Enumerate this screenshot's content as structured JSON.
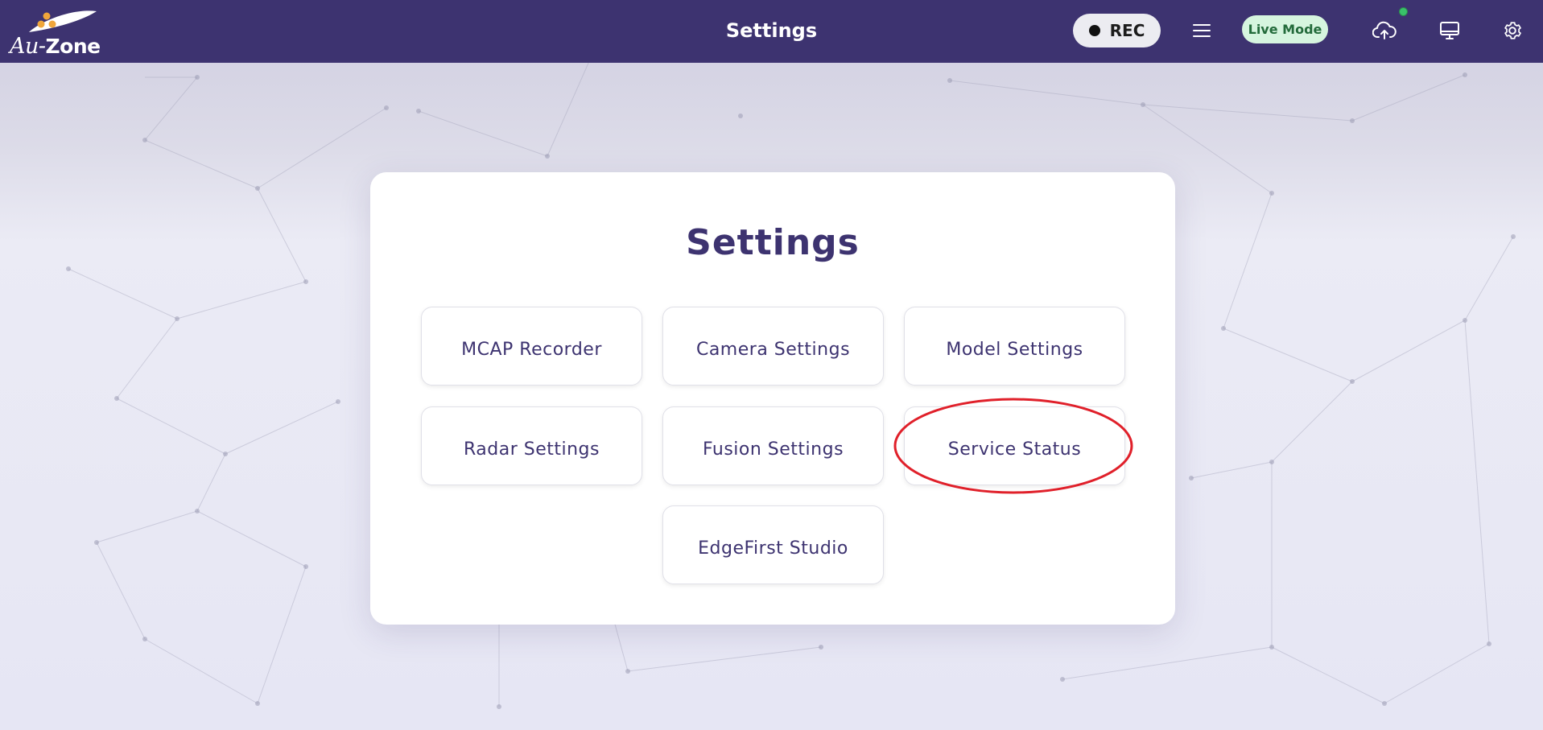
{
  "header": {
    "logo_text_prefix": "Au-",
    "logo_text_suffix": "Zone",
    "title": "Settings",
    "rec_label": "REC",
    "live_mode_label": "Live Mode",
    "icons": [
      "menu-icon",
      "cloud-upload-icon",
      "monitor-icon",
      "gear-icon"
    ]
  },
  "card": {
    "title": "Settings",
    "buttons": [
      {
        "label": "MCAP Recorder"
      },
      {
        "label": "Camera Settings"
      },
      {
        "label": "Model Settings"
      },
      {
        "label": "Radar Settings"
      },
      {
        "label": "Fusion Settings"
      },
      {
        "label": "Service Status"
      },
      {
        "label": "EdgeFirst Studio"
      }
    ]
  },
  "annotation": {
    "highlighted_item": "Service Status",
    "color": "#e0202a"
  },
  "colors": {
    "header_bg": "#3d3370",
    "primary_text": "#3d3370",
    "live_badge_bg": "#d6f5df",
    "live_badge_text": "#236b3b",
    "status_dot": "#39c16a"
  }
}
